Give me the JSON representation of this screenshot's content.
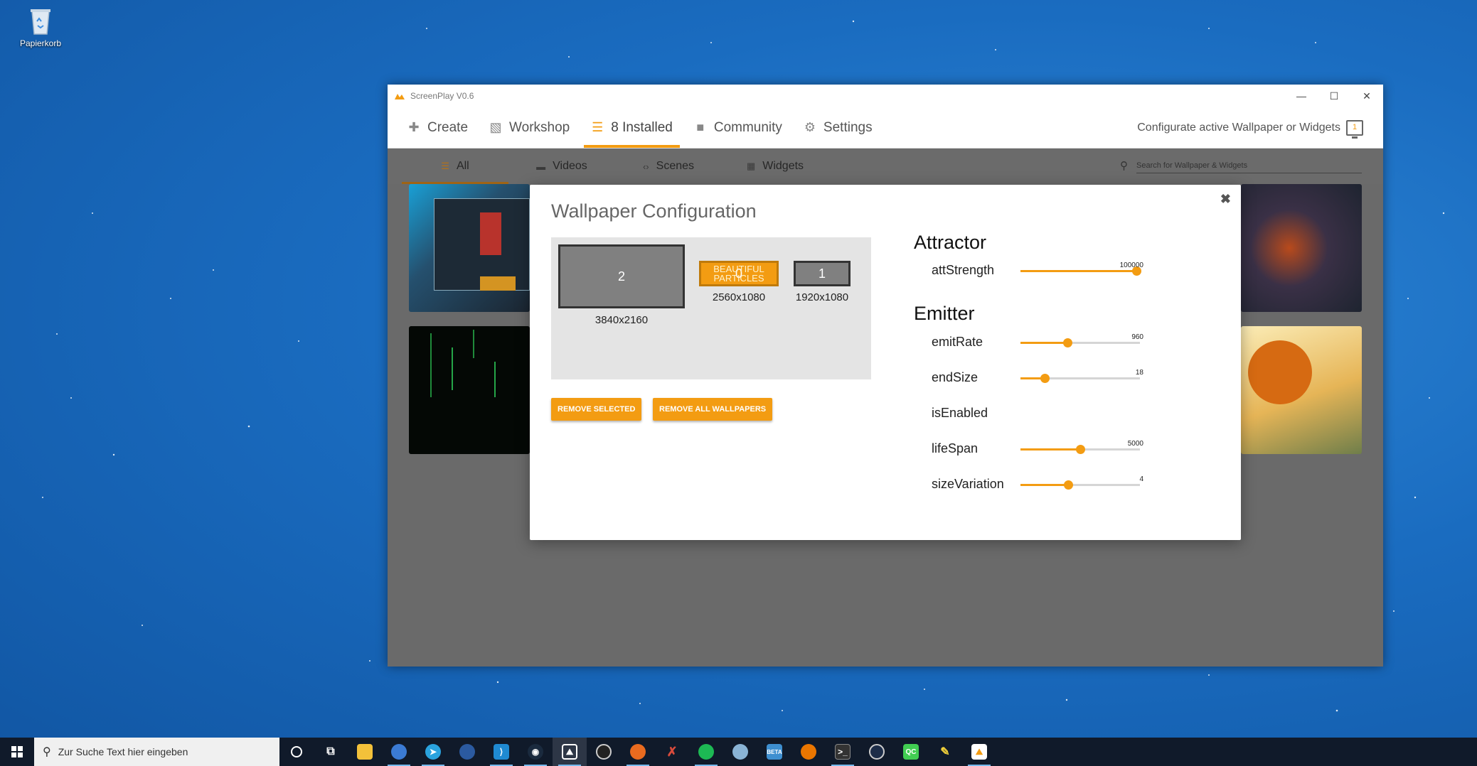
{
  "desktop": {
    "recycle_bin_label": "Papierkorb"
  },
  "window": {
    "title": "ScreenPlay V0.6",
    "nav": [
      {
        "label": "Create",
        "icon": "plus-icon"
      },
      {
        "label": "Workshop",
        "icon": "workshop-icon"
      },
      {
        "label": "8 Installed",
        "icon": "database-icon",
        "active": true
      },
      {
        "label": "Community",
        "icon": "chat-icon"
      },
      {
        "label": "Settings",
        "icon": "gear-icon"
      }
    ],
    "configure_label": "Configurate active Wallpaper or Widgets",
    "configure_badge": "1",
    "tabs": [
      {
        "label": "All",
        "active": true
      },
      {
        "label": "Videos"
      },
      {
        "label": "Scenes"
      },
      {
        "label": "Widgets"
      }
    ],
    "search_placeholder": "Search for Wallpaper & Widgets"
  },
  "dialog": {
    "title": "Wallpaper Configuration",
    "monitors": [
      {
        "index": "2",
        "resolution": "3840x2160",
        "selected": false
      },
      {
        "index": "0",
        "resolution": "2560x1080",
        "selected": true,
        "overlay": "BEAUTIFUL PARTICLES"
      },
      {
        "index": "1",
        "resolution": "1920x1080",
        "selected": false
      }
    ],
    "remove_selected": "REMOVE SELECTED",
    "remove_all": "REMOVE ALL WALLPAPERS",
    "sections": [
      {
        "title": "Attractor",
        "props": [
          {
            "name": "attStrength",
            "value": "100000",
            "fraction": 0.97
          }
        ]
      },
      {
        "title": "Emitter",
        "props": [
          {
            "name": "emitRate",
            "value": "960",
            "fraction": 0.39
          },
          {
            "name": "endSize",
            "value": "18",
            "fraction": 0.2
          },
          {
            "name": "isEnabled"
          },
          {
            "name": "lifeSpan",
            "value": "5000",
            "fraction": 0.5
          },
          {
            "name": "sizeVariation",
            "value": "4",
            "fraction": 0.4
          }
        ]
      }
    ]
  },
  "taskbar": {
    "search_placeholder": "Zur Suche Text hier eingeben",
    "apps": [
      "cortana-icon",
      "task-view-icon",
      "file-explorer-icon",
      "thunderbird-icon",
      "telegram-icon",
      "steam-chat-icon",
      "vscode-icon",
      "steam-icon",
      "screenplay-icon",
      "obs-icon",
      "firefox-icon",
      "gitkraken-icon",
      "spotify-icon",
      "github-desktop-icon",
      "beta-icon",
      "blender-icon",
      "terminal-icon",
      "keepass-icon",
      "qt-creator-icon",
      "inkscape-icon",
      "screenplay-tray-icon"
    ]
  }
}
